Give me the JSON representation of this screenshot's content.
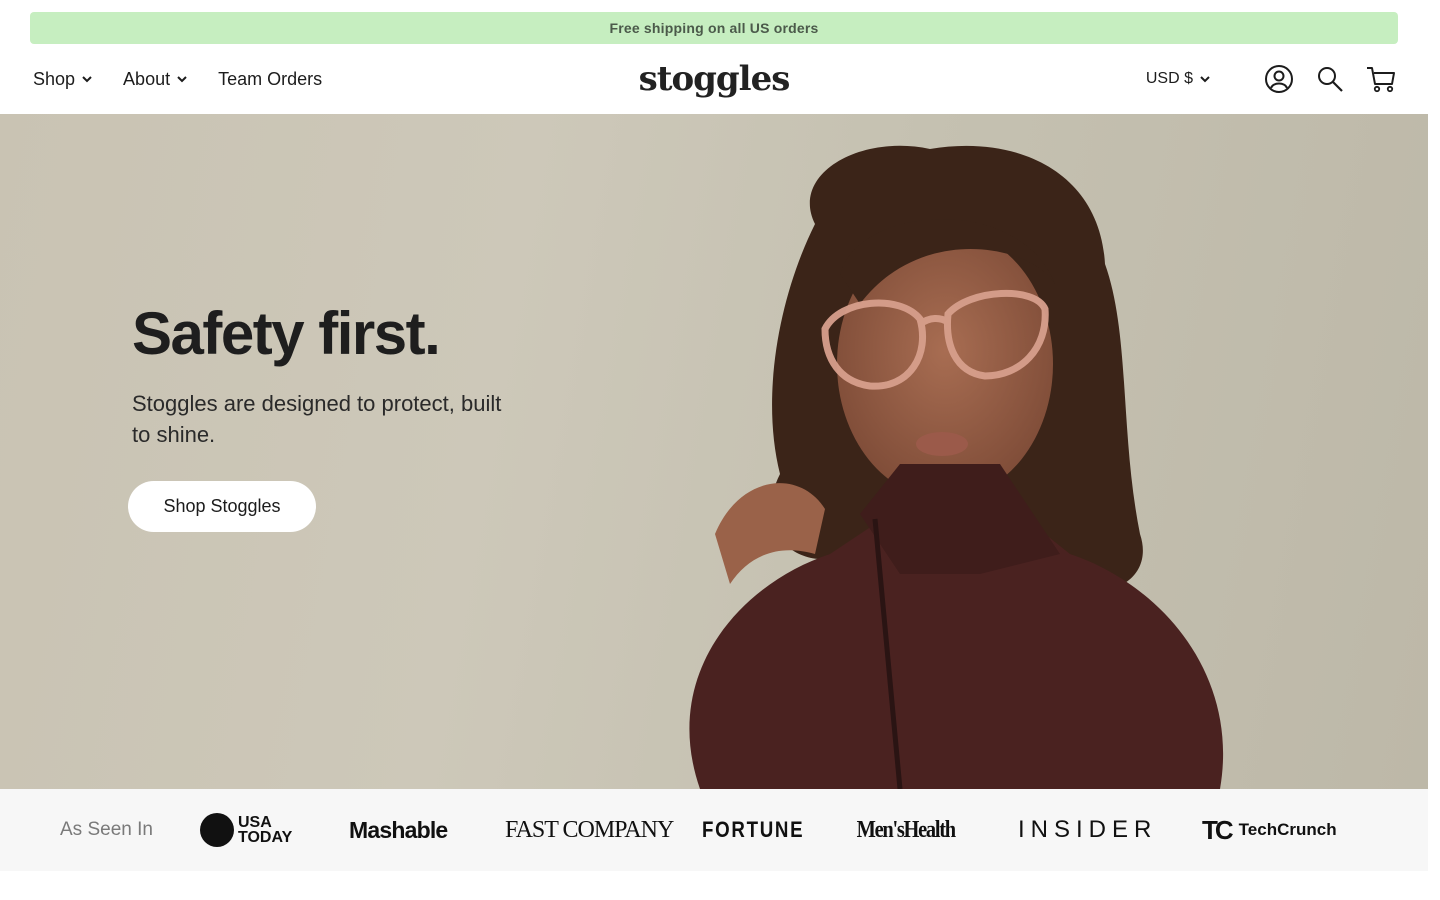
{
  "announcement": {
    "text": "Free shipping on all US orders"
  },
  "nav": {
    "items": [
      {
        "label": "Shop",
        "has_dropdown": true
      },
      {
        "label": "About",
        "has_dropdown": true
      },
      {
        "label": "Team Orders",
        "has_dropdown": false
      }
    ]
  },
  "brand": {
    "logo_text": "stoggles"
  },
  "header_right": {
    "currency_label": "USD $",
    "icons": [
      "account-icon",
      "search-icon",
      "cart-icon"
    ]
  },
  "hero": {
    "title": "Safety first.",
    "subtitle": "Stoggles are designed to protect, built to shine.",
    "cta_label": "Shop Stoggles"
  },
  "press": {
    "label": "As Seen In",
    "logos": {
      "usa_today_1": "USA",
      "usa_today_2": "TODAY",
      "mashable": "Mashable",
      "fast_company": "FAST COMPANY",
      "fortune": "FORTUNE",
      "mens_health": "Men'sHealth",
      "insider": "INSIDER",
      "techcrunch_mark": "TC",
      "techcrunch": "TechCrunch"
    }
  },
  "colors": {
    "announcement_bg": "#c6eec0",
    "hero_bg": "#c9c3b3",
    "jacket": "#4a2220",
    "press_bg": "#f7f7f7"
  }
}
